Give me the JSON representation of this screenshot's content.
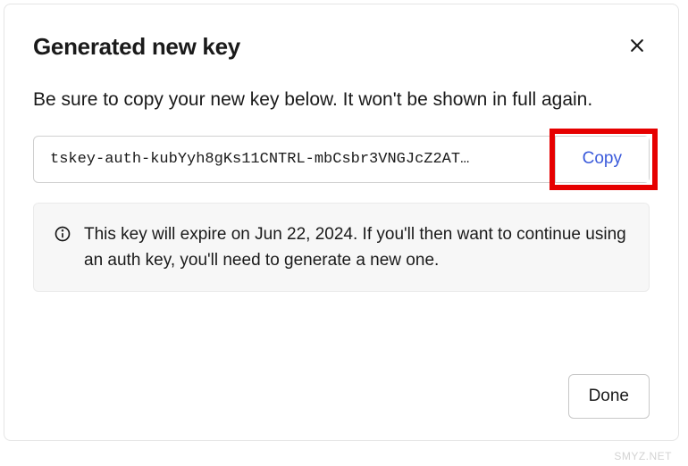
{
  "dialog": {
    "title": "Generated new key",
    "description": "Be sure to copy your new key below. It won't be shown in full again.",
    "key_value": "tskey-auth-kubYyh8gKs11CNTRL-mbCsbr3VNGJcZ2AT…",
    "copy_label": "Copy",
    "info_text": "This key will expire on Jun 22, 2024. If you'll then want to continue using an auth key, you'll need to generate a new one.",
    "done_label": "Done"
  },
  "watermark": "SMYZ.NET"
}
